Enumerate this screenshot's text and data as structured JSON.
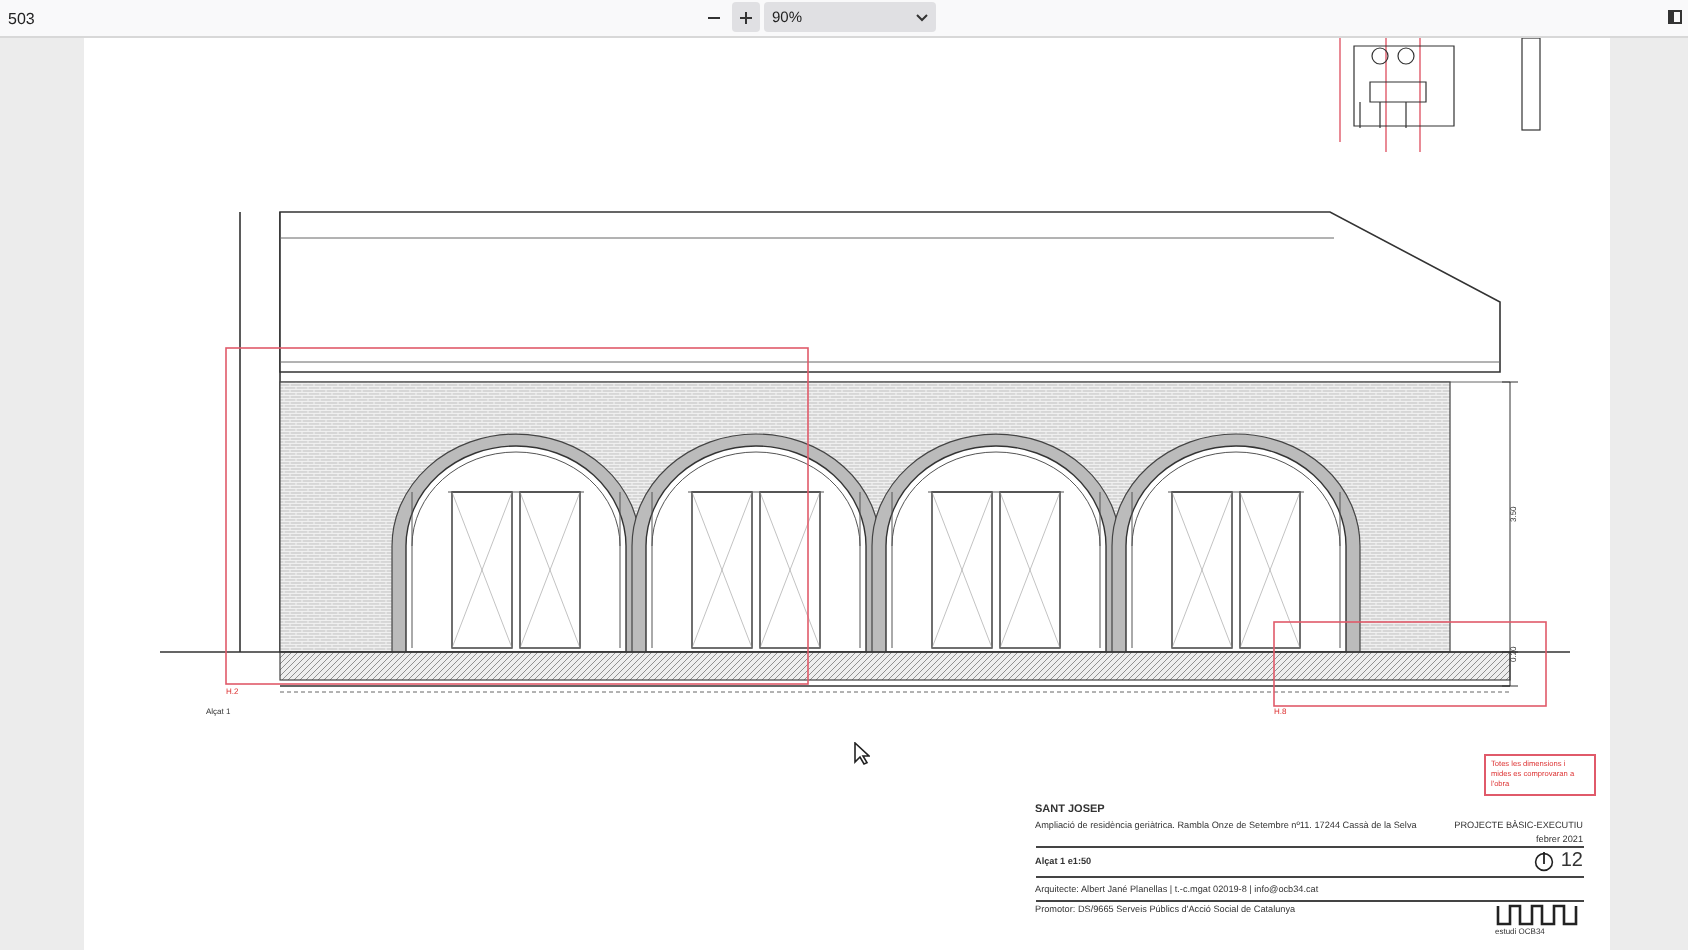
{
  "toolbar": {
    "page_label": "503",
    "zoom": "90%"
  },
  "drawing": {
    "labels": [
      {
        "text": "H.2",
        "kind": "marker"
      },
      {
        "text": "Alçat 1",
        "kind": "caption"
      },
      {
        "text": "H.8",
        "kind": "marker"
      },
      {
        "text": "3.50",
        "kind": "dimension"
      },
      {
        "text": "0.20",
        "kind": "dimension"
      }
    ]
  },
  "note": "Totes les dimensions i mides es comprovaran a l'obra",
  "title_block": {
    "project": "SANT JOSEP",
    "subtitle": "Ampliació de residència geriàtrica. Rambla Onze de Setembre nº11. 17244 Cassà de la Selva",
    "phase": "PROJECTE BÀSIC-EXECUTIU",
    "date": "febrer 2021",
    "sheet": "Alçat 1 e1:50",
    "number": "12",
    "architect": "Arquitecte:   Albert Jané Planellas | t.-c.mgat 02019-8 | info@ocb34.cat",
    "promoter": "Promotor:   DS/9665 Serveis Públics d'Acció Social de Catalunya",
    "studio": "estudi OCB34"
  }
}
